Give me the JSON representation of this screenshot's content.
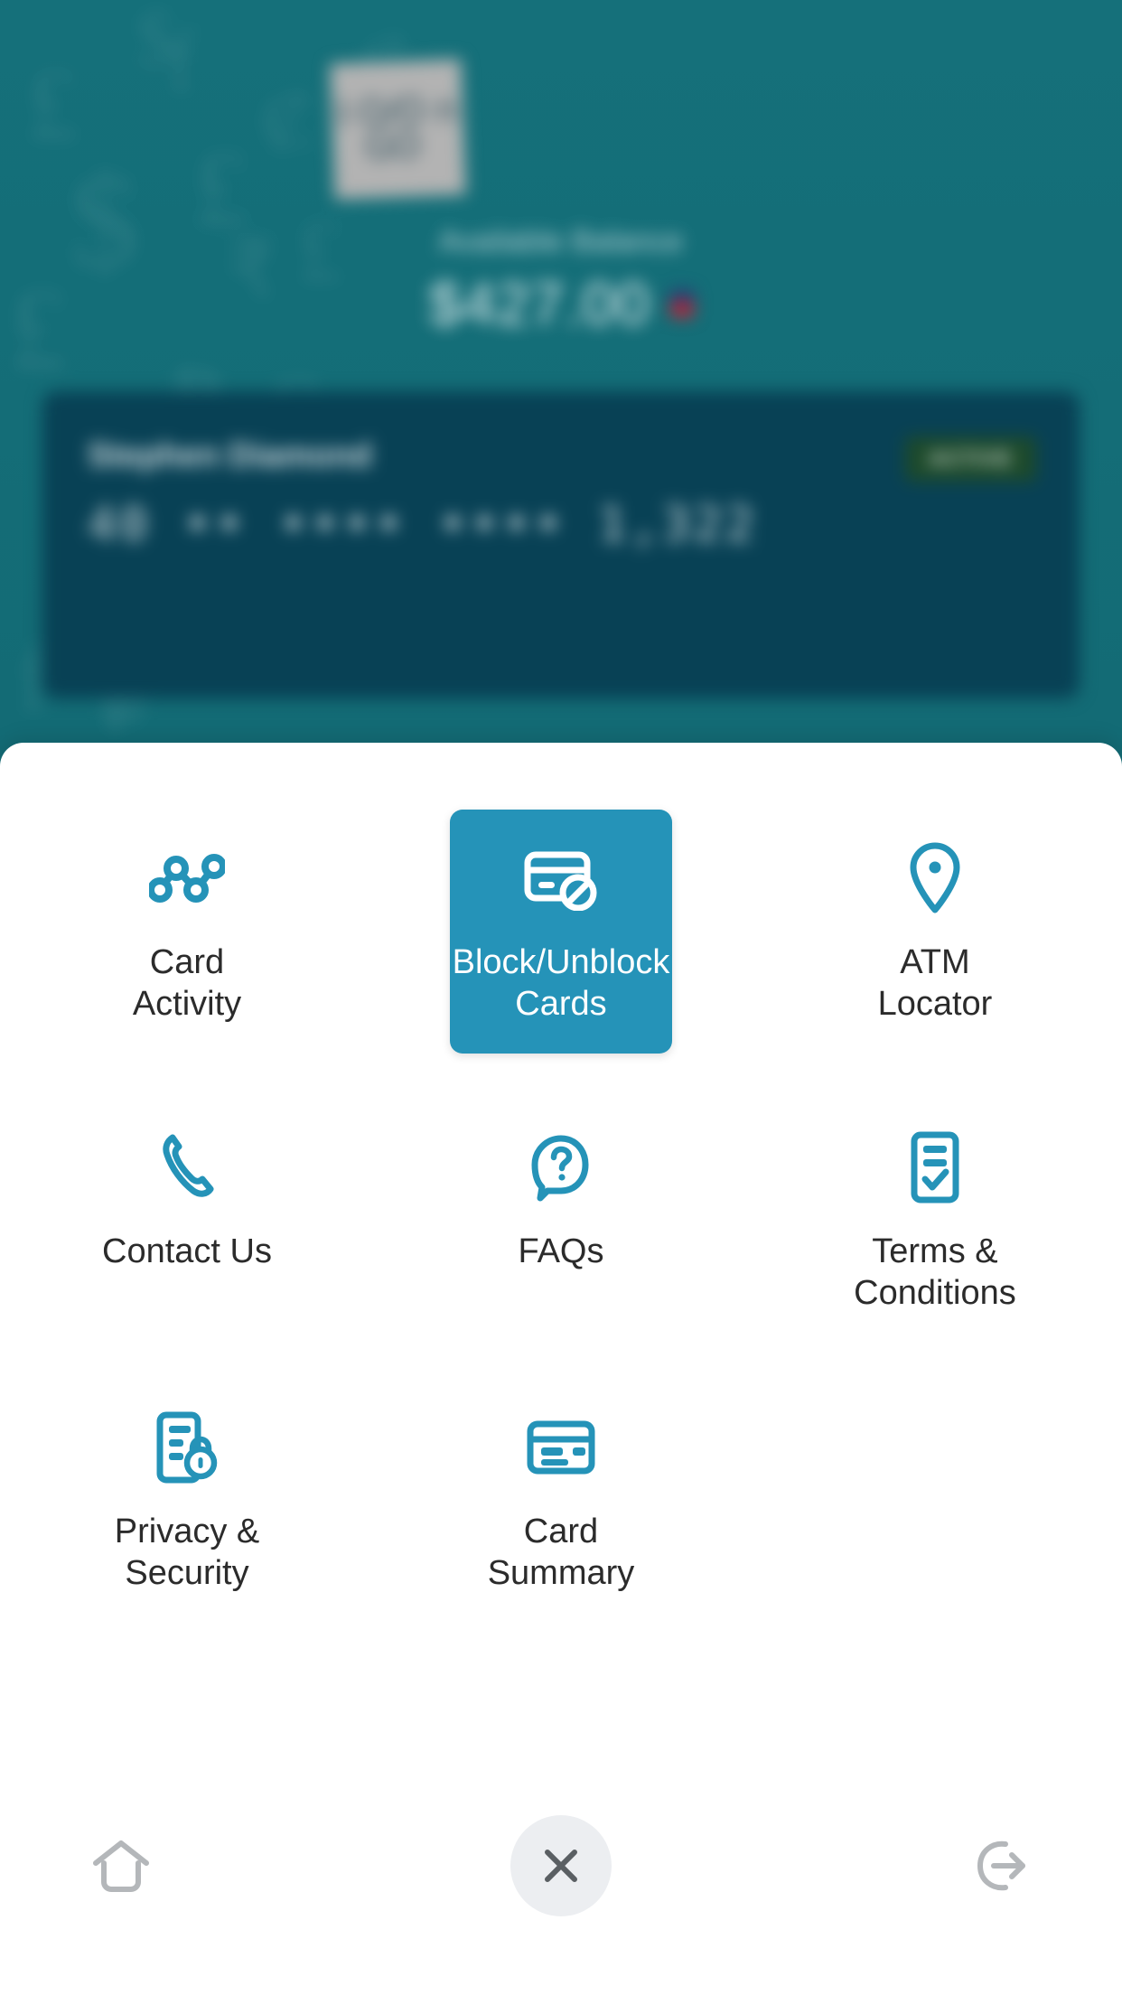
{
  "app": {
    "accent_color": "#2593b8",
    "backdrop_color": "#116a74",
    "card_panel_color": "#084155"
  },
  "backdrop": {
    "brand": {
      "logo_line1": "I O/O n",
      "logo_line2": "GO",
      "icon": "brand-logo-plaque"
    },
    "balance_label": "Available Balance",
    "balance_amount": "$427.00",
    "currency_flag": "us-flag-icon",
    "card": {
      "holder_name": "Stephen Diamond",
      "status_badge": "ACTIVE",
      "masked_number": "40 •• •••• •••• 1,322"
    },
    "currency_watermarks": [
      "$",
      "£",
      "₹",
      "£",
      "f",
      "¢",
      "₡",
      "$",
      "£",
      "₱",
      "₩",
      "$",
      "f",
      "₽",
      "¢",
      "£",
      "₮",
      "S"
    ]
  },
  "sheet": {
    "menu": [
      [
        {
          "label": "Card\nActivity",
          "icon": "card-activity-icon",
          "selected": false
        },
        {
          "label": "Block/Unblock\nCards",
          "icon": "block-unblock-card-icon",
          "selected": true
        },
        {
          "label": "ATM\nLocator",
          "icon": "map-pin-icon",
          "selected": false
        }
      ],
      [
        {
          "label": "Contact Us",
          "icon": "phone-icon",
          "selected": false
        },
        {
          "label": "FAQs",
          "icon": "question-bubble-icon",
          "selected": false
        },
        {
          "label": "Terms &\nConditions",
          "icon": "document-check-icon",
          "selected": false
        }
      ],
      [
        {
          "label": "Privacy &\nSecurity",
          "icon": "document-lock-icon",
          "selected": false
        },
        {
          "label": "Card\nSummary",
          "icon": "card-summary-icon",
          "selected": false
        },
        {
          "label": "",
          "icon": "",
          "selected": false
        }
      ]
    ],
    "action_bar": {
      "home": {
        "label": "Home",
        "icon": "home-icon"
      },
      "close": {
        "label": "Close",
        "icon": "close-x-icon"
      },
      "logout": {
        "label": "Logout",
        "icon": "logout-icon"
      }
    }
  }
}
